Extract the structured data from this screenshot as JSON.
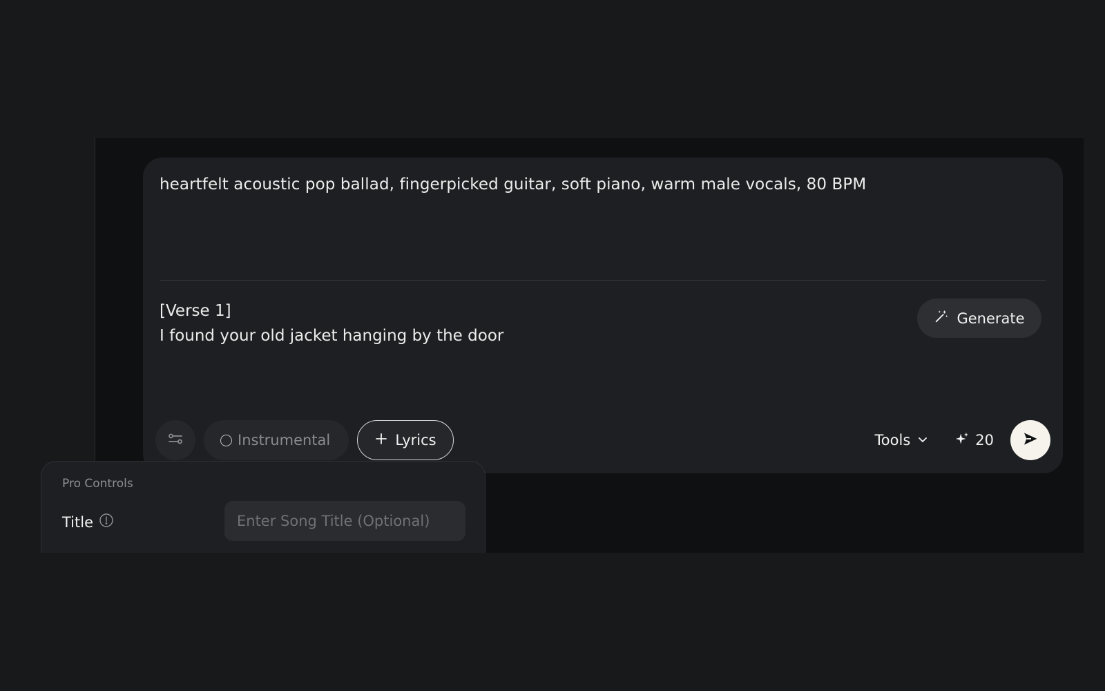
{
  "composer": {
    "style_prompt": "heartfelt acoustic pop ballad, fingerpicked guitar, soft piano, warm male vocals, 80 BPM",
    "lyrics": "[Verse 1]\nI found your old jacket hanging by the door",
    "generate_label": "Generate",
    "instrumental_label": "Instrumental",
    "lyrics_label": "Lyrics",
    "tools_label": "Tools",
    "credits": "20"
  },
  "pro_controls": {
    "heading": "Pro Controls",
    "title_label": "Title",
    "title_placeholder": "Enter Song Title (Optional)",
    "title_value": ""
  },
  "colors": {
    "background": "#18191b",
    "stage": "#0f1012",
    "card": "#1e1f22",
    "pill": "#26272a",
    "send_button": "#f5f3ec"
  },
  "icons": {
    "settings": "sliders-icon",
    "generate": "magic-wand-icon",
    "lyrics_add": "plus-icon",
    "tools_dropdown": "chevron-down-icon",
    "credits": "sparkle-icon",
    "send": "send-icon",
    "title_info": "info-icon"
  }
}
